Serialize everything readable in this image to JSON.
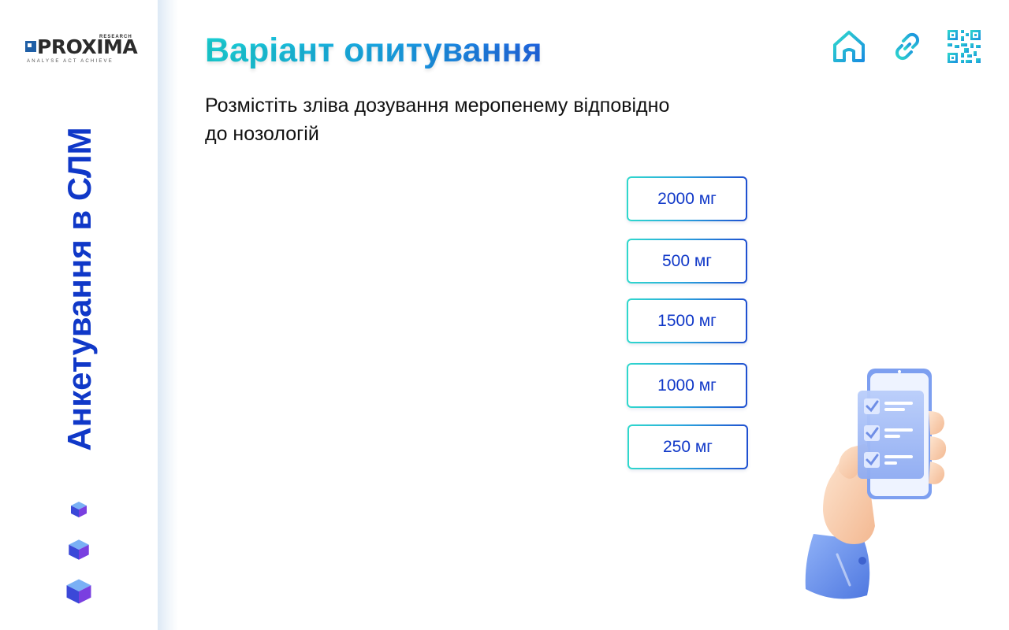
{
  "brand": {
    "logo_text": "PROXIMA",
    "logo_sub": "RESEARCH",
    "logo_tagline": "ANALYSE  ACT  ACHIEVE"
  },
  "sidebar": {
    "vertical_title": "Анкетування в СЛМ"
  },
  "header": {
    "title": "Варіант опитування",
    "icons": [
      "home-icon",
      "link-icon",
      "qr-code-icon"
    ]
  },
  "question": {
    "instruction": "Розмістіть зліва дозування меропенему відповідно до нозологій"
  },
  "options": [
    {
      "label": "2000 мг"
    },
    {
      "label": "500 мг"
    },
    {
      "label": "1500 мг"
    },
    {
      "label": "1000 мг"
    },
    {
      "label": "250 мг"
    }
  ],
  "colors": {
    "accent_blue": "#1038c8",
    "accent_teal": "#1bd2d6",
    "sidebar_shadow": "#dde9f5"
  }
}
